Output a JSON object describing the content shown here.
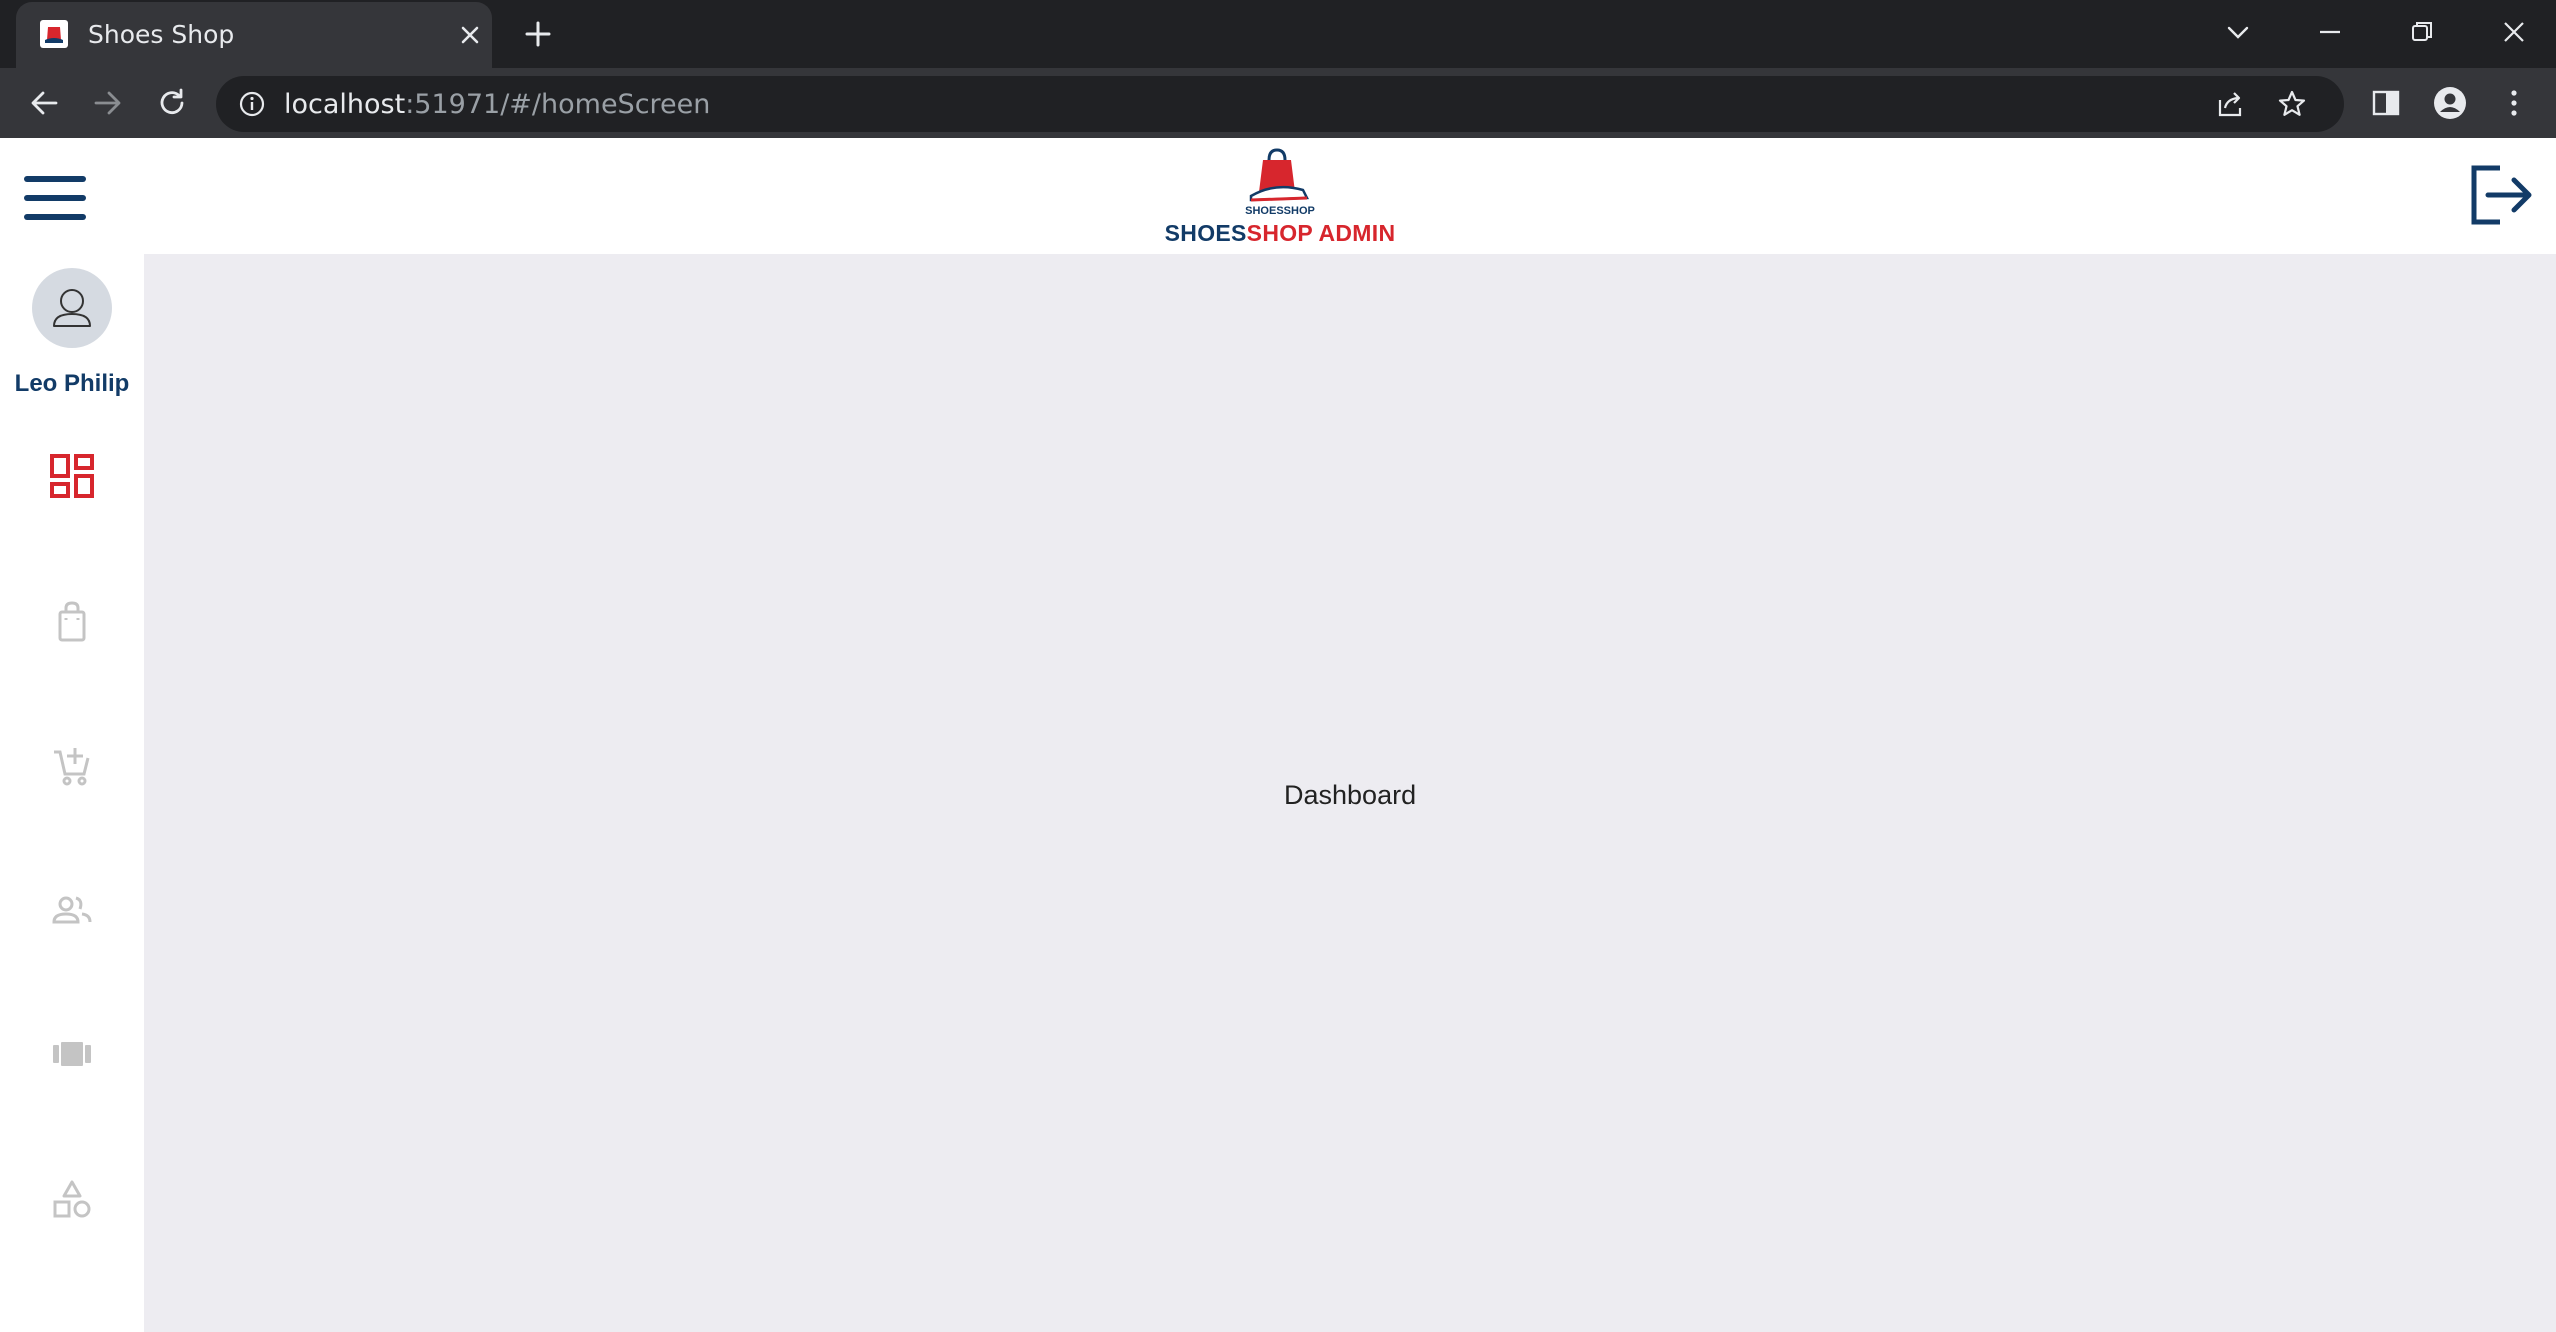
{
  "browser": {
    "tab_title": "Shoes Shop",
    "url_host": "localhost",
    "url_rest": ":51971/#/homeScreen"
  },
  "app": {
    "brand_part1": "SHOES",
    "brand_part2": "SHOP ADMIN",
    "logo_text": "SHOESSHOP",
    "user_name": "Leo Philip",
    "main_title": "Dashboard"
  },
  "sidebar": {
    "items": [
      {
        "id": "dashboard",
        "icon": "dashboard-icon",
        "active": true
      },
      {
        "id": "products",
        "icon": "shopping-bag-icon",
        "active": false
      },
      {
        "id": "orders",
        "icon": "add-cart-icon",
        "active": false
      },
      {
        "id": "users",
        "icon": "people-icon",
        "active": false
      },
      {
        "id": "brands",
        "icon": "view-carousel-icon",
        "active": false
      },
      {
        "id": "categories",
        "icon": "category-icon",
        "active": false
      }
    ]
  },
  "colors": {
    "brand_blue": "#123b67",
    "brand_red": "#d7262d",
    "inactive_icon": "#c4c4c4",
    "content_bg": "#edecf1"
  }
}
